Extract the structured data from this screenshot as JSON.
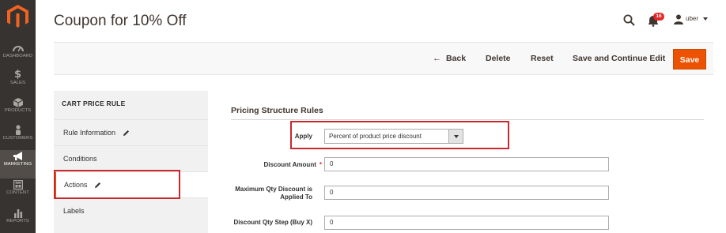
{
  "sidebar": {
    "items": [
      {
        "label": "DASHBOARD",
        "icon": "dashboard-icon"
      },
      {
        "label": "SALES",
        "icon": "dollar-icon",
        "glyph": "$"
      },
      {
        "label": "PRODUCTS",
        "icon": "cube-icon"
      },
      {
        "label": "CUSTOMERS",
        "icon": "person-icon"
      },
      {
        "label": "MARKETING",
        "icon": "megaphone-icon"
      },
      {
        "label": "CONTENT",
        "icon": "layout-icon"
      },
      {
        "label": "REPORTS",
        "icon": "bar-chart-icon"
      }
    ],
    "active": "MARKETING"
  },
  "header": {
    "title": "Coupon for 10% Off",
    "notifications_count": "16",
    "user_name": "uber"
  },
  "actions": {
    "back": "Back",
    "delete": "Delete",
    "reset": "Reset",
    "save_continue": "Save and Continue Edit",
    "save": "Save"
  },
  "tabs": {
    "heading": "CART PRICE RULE",
    "items": [
      {
        "label": "Rule Information",
        "edited": true
      },
      {
        "label": "Conditions",
        "edited": false
      },
      {
        "label": "Actions",
        "edited": true
      },
      {
        "label": "Labels",
        "edited": false
      }
    ],
    "active": "Actions"
  },
  "form": {
    "section_title": "Pricing Structure Rules",
    "apply": {
      "label": "Apply",
      "value": "Percent of product price discount"
    },
    "discount_amount": {
      "label": "Discount Amount",
      "value": "0",
      "required": true
    },
    "max_qty": {
      "label_line1": "Maximum Qty Discount is",
      "label_line2": "Applied To",
      "value": "0"
    },
    "qty_step": {
      "label": "Discount Qty Step (Buy X)",
      "value": "0"
    }
  },
  "colors": {
    "sidebar": "#373330",
    "accent": "#eb5202",
    "highlight": "#c9282d",
    "badge": "#e22626"
  }
}
